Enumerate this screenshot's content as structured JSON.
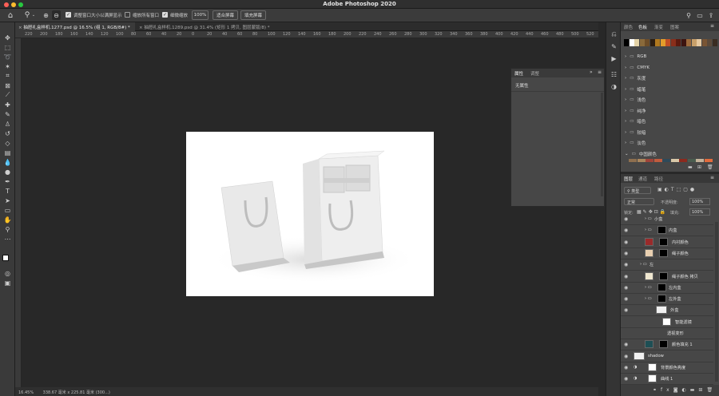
{
  "app": {
    "title": "Adobe Photoshop 2020"
  },
  "options": {
    "resize_windows": "调整窗口大小以满屏显示",
    "zoom_all": "缩放所有窗口",
    "scrubby_zoom": "细微缩放",
    "zoom_value": "100%",
    "fit_screen": "适合屏幕",
    "fill_screen": "填充屏幕"
  },
  "tabs": [
    {
      "label": "抽屉礼盒样机.1277.psd @ 16.5% (组 1, RGB/8#) *"
    },
    {
      "label": "抽屉礼盒样机.1289.psd @ 31.4% (矩形 1 拷贝, 图层蒙版/8) *"
    }
  ],
  "ruler": [
    "220",
    "200",
    "180",
    "160",
    "140",
    "120",
    "100",
    "80",
    "60",
    "40",
    "20",
    "0",
    "20",
    "40",
    "60",
    "80",
    "100",
    "120",
    "140",
    "160",
    "180",
    "200",
    "220",
    "240",
    "260",
    "280",
    "300",
    "320",
    "340",
    "360",
    "380",
    "400",
    "420",
    "440",
    "460",
    "480",
    "500",
    "520",
    "540"
  ],
  "status": {
    "zoom": "16.45%",
    "size": "338.67 毫米 x 225.81 毫米 (300...)"
  },
  "properties": {
    "tab1": "属性",
    "tab2": "调整",
    "empty": "无属性"
  },
  "swatches": {
    "tabs": [
      "颜色",
      "色板",
      "渐变",
      "图案"
    ],
    "colors": [
      "#000000",
      "#ffffff",
      "#e4d3a7",
      "#8a6a3b",
      "#6d4d28",
      "#2d1e10",
      "#b0781e",
      "#e49d2b",
      "#c34f23",
      "#8a2e1a",
      "#5c1a0f",
      "#3d1410",
      "#9e6a3c",
      "#c8a06a",
      "#e6c9a0",
      "#7a5534",
      "#5c4a3a",
      "#3a2c22"
    ],
    "folders": [
      "RGB",
      "CMYK",
      "灰度",
      "蜡笔",
      "浅色",
      "纯净",
      "暗色",
      "较暗",
      "淡色",
      "中国颜色"
    ],
    "china_colors": [
      "#8e6f4f",
      "#a9865d",
      "#a04339",
      "#c15c3e",
      "#2e4a5a",
      "#d8c8a8",
      "#8c2a1e",
      "#4a5d4f",
      "#c4b29a",
      "#e36b3c"
    ]
  },
  "layers": {
    "tabs": [
      "图层",
      "通道",
      "路径"
    ],
    "filter_kind": "类型",
    "blend_mode": "正常",
    "opacity_label": "不透明度:",
    "opacity": "100%",
    "lock_label": "锁定:",
    "fill_label": "填充:",
    "fill": "100%",
    "items": [
      {
        "name": "小盒",
        "type": "group"
      },
      {
        "name": "内盒",
        "type": "group"
      },
      {
        "name": "内衬颜色",
        "type": "color",
        "color": "#9a2a2a"
      },
      {
        "name": "绳子颜色",
        "type": "color",
        "color": "#e8cfb0"
      },
      {
        "name": "左",
        "type": "group"
      },
      {
        "name": "绳子颜色 拷贝",
        "type": "color",
        "color": "#efe7d0"
      },
      {
        "name": "左内盒",
        "type": "group"
      },
      {
        "name": "左外盒",
        "type": "group"
      },
      {
        "name": "外盒",
        "type": "smart"
      },
      {
        "name": "智能滤镜",
        "type": "filter"
      },
      {
        "name": "透视变形",
        "type": "effect"
      },
      {
        "name": "颜色填充 1",
        "type": "color",
        "color": "#1e4f55"
      },
      {
        "name": "shadow",
        "type": "pixel"
      },
      {
        "name": "背景颜色亮度",
        "type": "adjust"
      },
      {
        "name": "曲线 1",
        "type": "adjust"
      }
    ]
  }
}
